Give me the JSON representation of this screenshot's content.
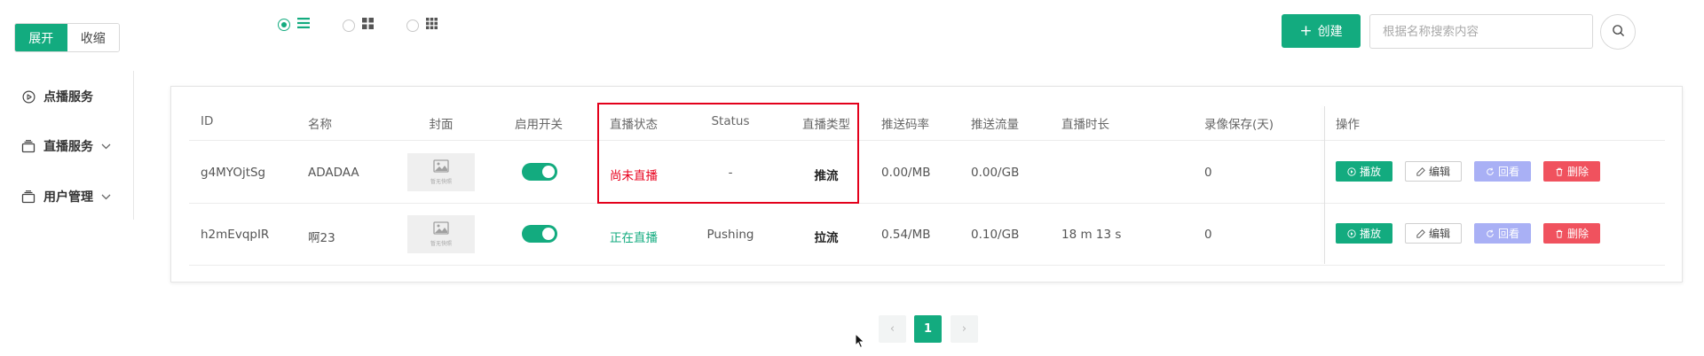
{
  "sidebar": {
    "expand_label": "展开",
    "collapse_label": "收缩",
    "items": [
      {
        "label": "点播服务",
        "icon": "play-circle-icon"
      },
      {
        "label": "直播服务",
        "icon": "stack-icon"
      },
      {
        "label": "用户管理",
        "icon": "stack-icon"
      }
    ]
  },
  "view_modes": [
    "list-view-icon",
    "grid-view-icon",
    "dense-grid-view-icon"
  ],
  "toolbar": {
    "create_label": "创建",
    "search_placeholder": "根据名称搜索内容"
  },
  "table": {
    "headers": {
      "id": "ID",
      "name": "名称",
      "cover": "封面",
      "enabled": "启用开关",
      "live_status": "直播状态",
      "status": "Status",
      "live_type": "直播类型",
      "bitrate": "推送码率",
      "traffic": "推送流量",
      "duration": "直播时长",
      "record_days": "录像保存(天)",
      "actions": "操作"
    },
    "cover_placeholder": "暂无快照",
    "rows": [
      {
        "id": "g4MYOjtSg",
        "name": "ADADAA",
        "enabled": true,
        "live_status": "尚未直播",
        "status": "-",
        "live_type": "推流",
        "bitrate": "0.00/MB",
        "traffic": "0.00/GB",
        "duration": "",
        "record_days": "0"
      },
      {
        "id": "h2mEvqpIR",
        "name": "啊23",
        "enabled": true,
        "live_status": "正在直播",
        "status": "Pushing",
        "live_type": "拉流",
        "bitrate": "0.54/MB",
        "traffic": "0.10/GB",
        "duration": "18 m 13 s",
        "record_days": "0"
      }
    ],
    "actions": {
      "play": "播放",
      "edit": "编辑",
      "replay": "回看",
      "delete": "删除"
    }
  },
  "pagination": {
    "prev": "‹",
    "current": "1",
    "next": "›"
  },
  "colors": {
    "primary": "#13ab7f",
    "danger": "#f0525e",
    "replay": "#a9b0f5",
    "highlight": "#e3001b"
  }
}
